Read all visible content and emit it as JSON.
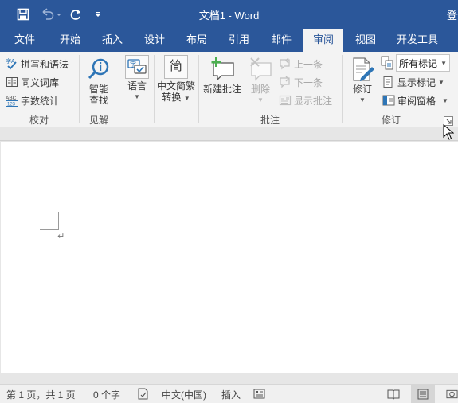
{
  "titlebar": {
    "title": "文档1 - Word",
    "signin": "登录"
  },
  "quick_access": {
    "icons": [
      "save-icon",
      "undo-icon",
      "redo-icon",
      "customize-icon"
    ]
  },
  "tabs": [
    {
      "label": "文件"
    },
    {
      "label": "开始"
    },
    {
      "label": "插入"
    },
    {
      "label": "设计"
    },
    {
      "label": "布局"
    },
    {
      "label": "引用"
    },
    {
      "label": "邮件"
    },
    {
      "label": "审阅",
      "active": true
    },
    {
      "label": "视图"
    },
    {
      "label": "开发工具"
    }
  ],
  "ribbon": {
    "proofing": {
      "spelling": "拼写和语法",
      "thesaurus": "同义词库",
      "word_count": "字数统计",
      "label": "校对"
    },
    "insights": {
      "smart_lookup_line1": "智能",
      "smart_lookup_line2": "查找",
      "label": "见解"
    },
    "language": {
      "language": "语言"
    },
    "chinese_conversion": {
      "line1": "中文简繁",
      "line2": "转换",
      "icon_char": "简"
    },
    "comments": {
      "new_comment": "新建批注",
      "delete": "删除",
      "previous": "上一条",
      "next": "下一条",
      "show_comments": "显示批注",
      "label": "批注"
    },
    "tracking": {
      "track_changes": "修订",
      "markup_option": "所有标记",
      "show_markup": "显示标记",
      "reviewing_pane": "审阅窗格",
      "label": "修订"
    }
  },
  "statusbar": {
    "page": "第 1 页，共 1 页",
    "words": "0 个字",
    "language": "中文(中国)",
    "mode": "插入"
  },
  "colors": {
    "brand": "#2b579a",
    "ribbon_bg": "#f3f3f3",
    "accent_blue": "#2e75b6"
  }
}
